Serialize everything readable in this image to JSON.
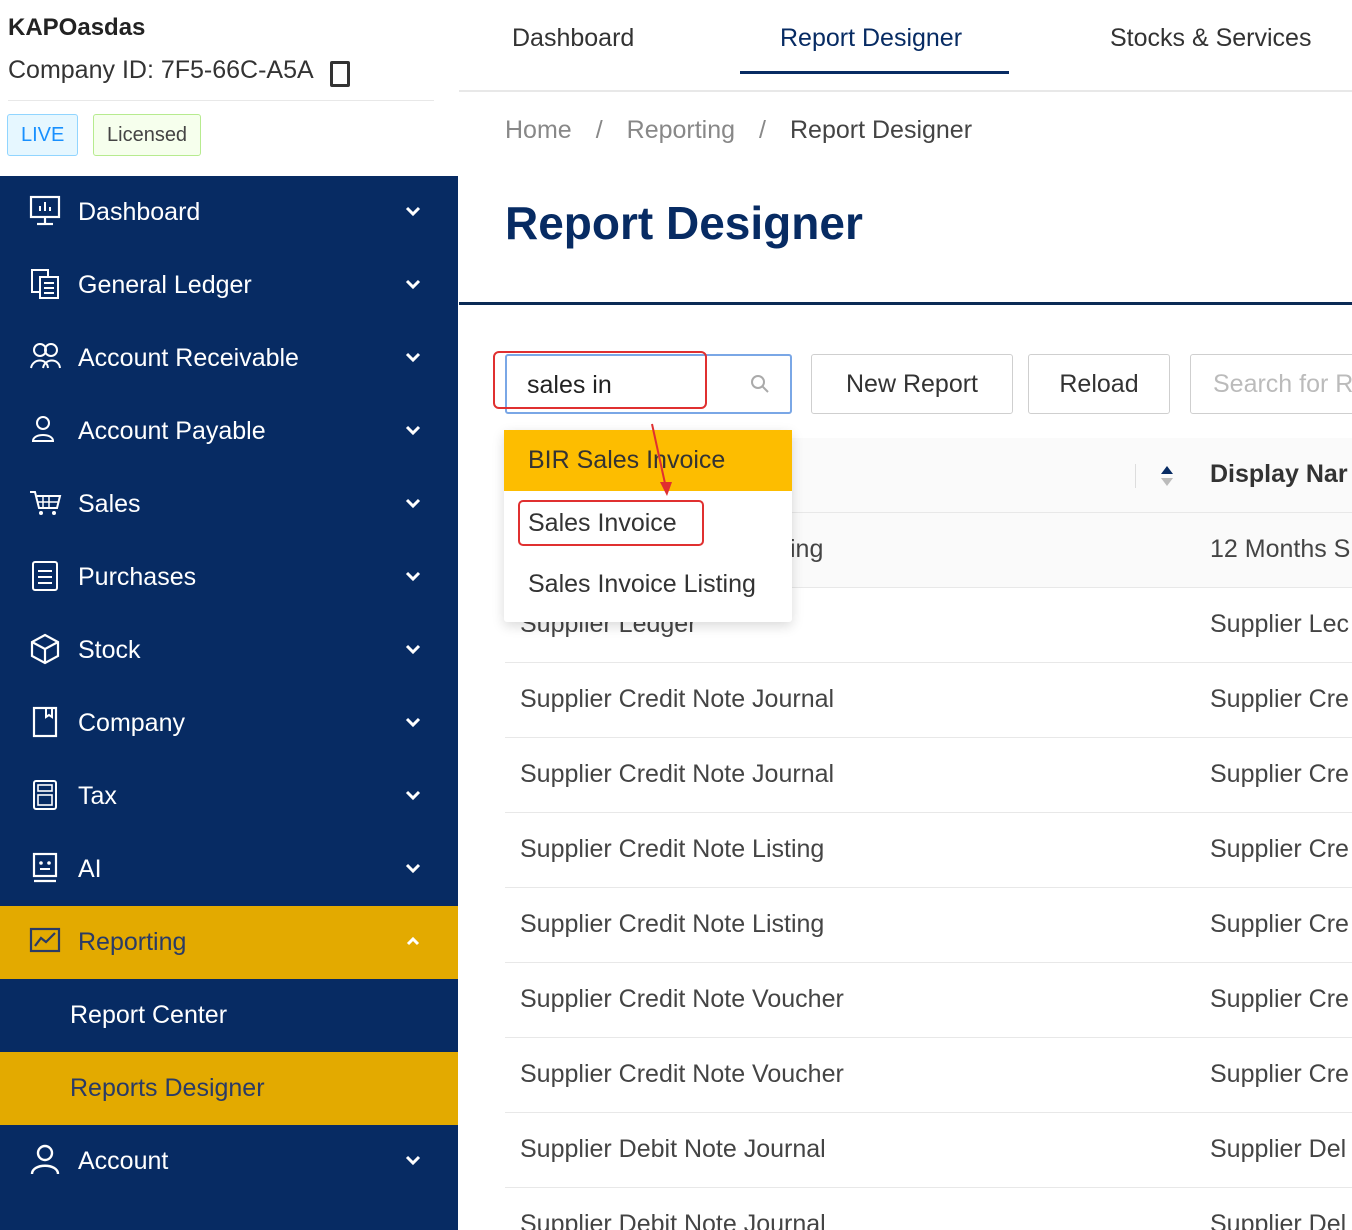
{
  "company": {
    "name": "KAPOasdas",
    "id_text": "Company ID: 7F5-66C-A5A",
    "badges": [
      "LIVE",
      "Licensed"
    ]
  },
  "sidebar": {
    "items": [
      {
        "label": "Dashboard",
        "icon": "monitor-chart-icon"
      },
      {
        "label": "General Ledger",
        "icon": "ledger-icon"
      },
      {
        "label": "Account Receivable",
        "icon": "handshake-icon"
      },
      {
        "label": "Account Payable",
        "icon": "person-icon"
      },
      {
        "label": "Sales",
        "icon": "cart-icon"
      },
      {
        "label": "Purchases",
        "icon": "document-icon"
      },
      {
        "label": "Stock",
        "icon": "box-icon"
      },
      {
        "label": "Company",
        "icon": "book-icon"
      },
      {
        "label": "Tax",
        "icon": "calculator-icon"
      },
      {
        "label": "AI",
        "icon": "ai-icon"
      },
      {
        "label": "Reporting",
        "icon": "line-chart-icon",
        "expanded": true
      },
      {
        "label": "Account",
        "icon": "user-icon"
      }
    ],
    "sub_items": [
      "Report Center",
      "Reports Designer"
    ],
    "active_sub": "Reports Designer",
    "colors": {
      "background": "#072b63",
      "active": "#e3aa00"
    }
  },
  "topnav": {
    "tabs": [
      "Dashboard",
      "Report Designer",
      "Stocks & Services"
    ],
    "active": "Report Designer"
  },
  "breadcrumb": [
    "Home",
    "Reporting",
    "Report Designer"
  ],
  "breadcrumb_sep": "/",
  "page_title": "Report Designer",
  "toolbar": {
    "search_value": "sales in",
    "new_report_label": "New Report",
    "reload_label": "Reload",
    "search2_placeholder": "Search for R"
  },
  "autocomplete": {
    "options": [
      "BIR Sales Invoice",
      "Sales Invoice",
      "Sales Invoice Listing"
    ],
    "highlighted": "BIR Sales Invoice",
    "annotated": "Sales Invoice"
  },
  "table": {
    "display_header": "Display Nar",
    "rows": [
      {
        "name": "ing",
        "display": "12 Months S"
      },
      {
        "name": "Supplier Ledger",
        "display": "Supplier Lec"
      },
      {
        "name": "Supplier Credit Note Journal",
        "display": "Supplier Cre"
      },
      {
        "name": "Supplier Credit Note Journal",
        "display": "Supplier Cre"
      },
      {
        "name": "Supplier Credit Note Listing",
        "display": "Supplier Cre"
      },
      {
        "name": "Supplier Credit Note Listing",
        "display": "Supplier Cre"
      },
      {
        "name": "Supplier Credit Note Voucher",
        "display": "Supplier Cre"
      },
      {
        "name": "Supplier Credit Note Voucher",
        "display": "Supplier Cre"
      },
      {
        "name": "Supplier Debit Note Journal",
        "display": "Supplier Del"
      },
      {
        "name": "Supplier Debit Note Journal",
        "display": "Supplier Del"
      }
    ]
  }
}
